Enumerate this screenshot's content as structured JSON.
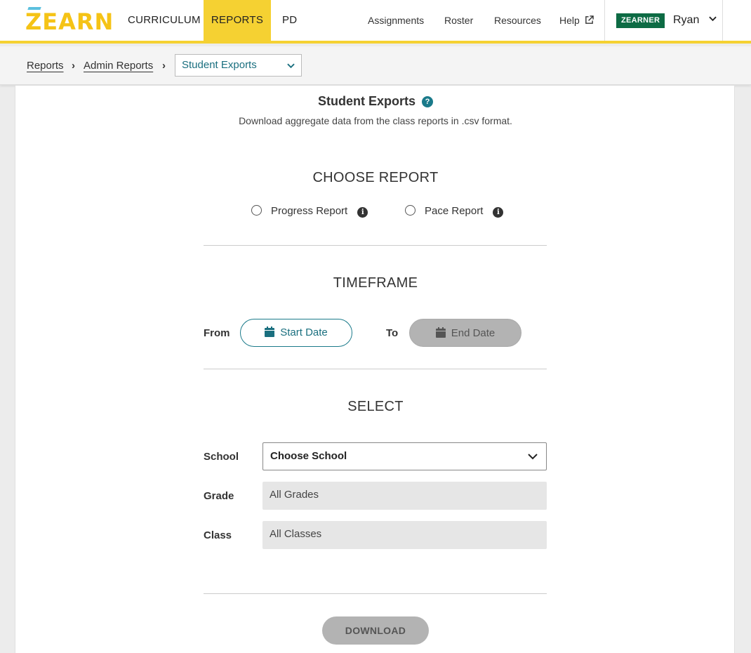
{
  "header": {
    "logo": "ZEARN",
    "nav": [
      {
        "label": "CURRICULUM"
      },
      {
        "label": "REPORTS"
      },
      {
        "label": "PD"
      }
    ],
    "utility": {
      "assignments": "Assignments",
      "roster": "Roster",
      "resources": "Resources",
      "help": "Help"
    },
    "badge": "ZEARNER",
    "user": "Ryan"
  },
  "breadcrumb": {
    "items": [
      "Reports",
      "Admin Reports"
    ],
    "separator": "›",
    "selected": "Student Exports"
  },
  "main": {
    "title": "Student Exports",
    "subtitle": "Download aggregate data from the class reports in .csv format.",
    "choose_report": {
      "heading": "CHOOSE REPORT",
      "options": [
        "Progress Report",
        "Pace Report"
      ]
    },
    "timeframe": {
      "heading": "TIMEFRAME",
      "from_label": "From",
      "to_label": "To",
      "start_label": "Start Date",
      "end_label": "End Date"
    },
    "select": {
      "heading": "SELECT",
      "school_label": "School",
      "school_value": "Choose School",
      "grade_label": "Grade",
      "grade_value": "All Grades",
      "class_label": "Class",
      "class_value": "All Classes"
    },
    "download_label": "DOWNLOAD"
  },
  "colors": {
    "brand_yellow": "#f5d132",
    "teal": "#1a7a8a",
    "badge_green": "#0d6b44",
    "disabled_gray": "#b3b3b3"
  }
}
